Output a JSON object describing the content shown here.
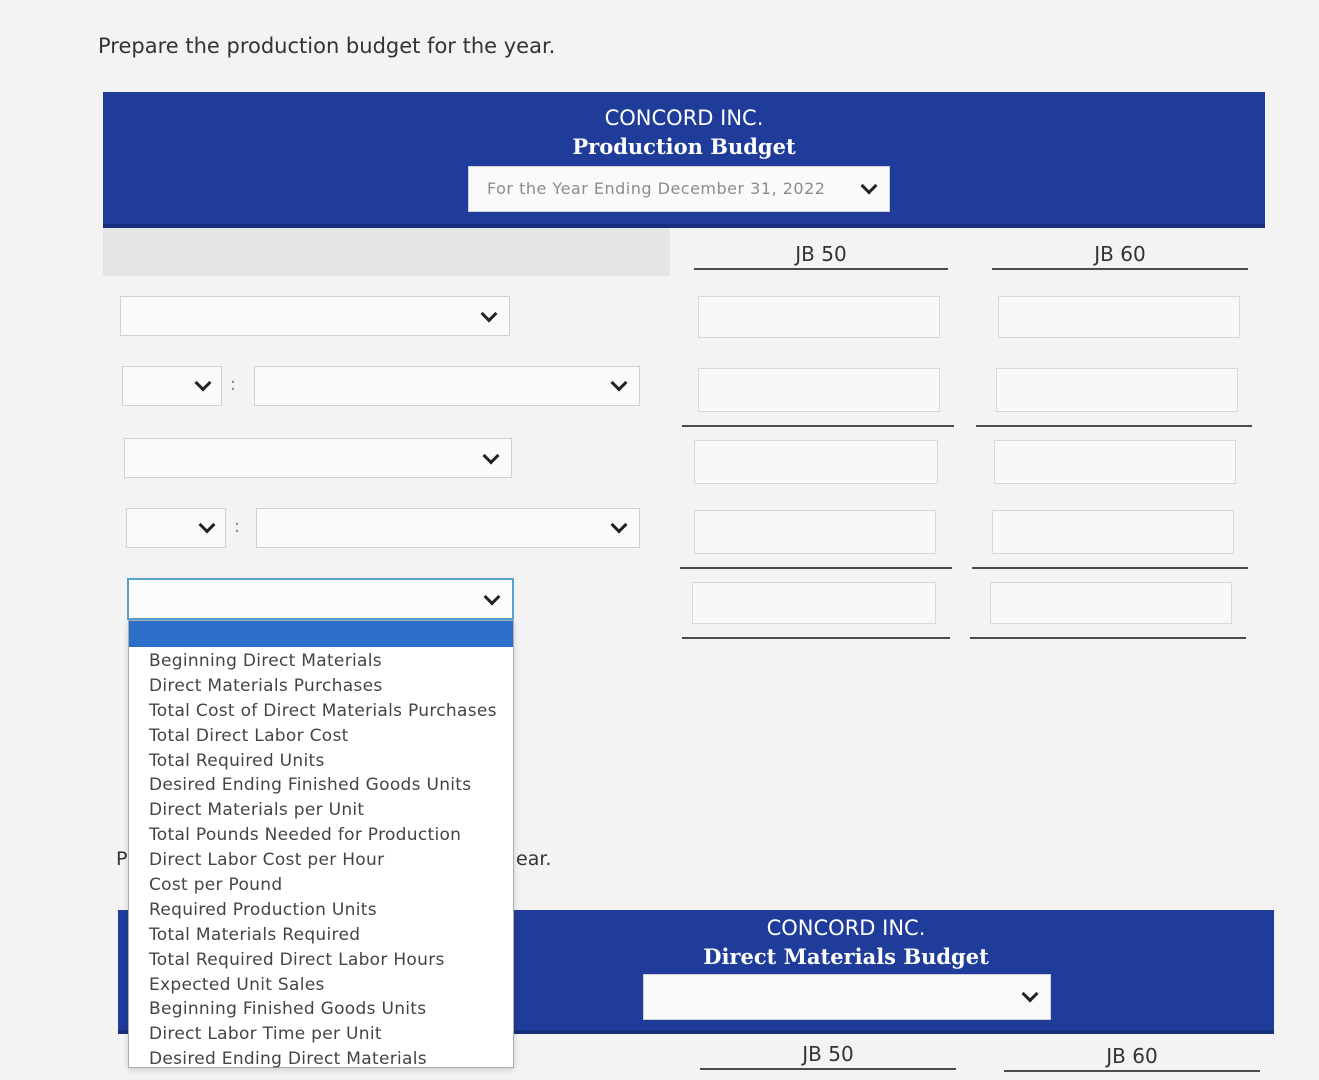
{
  "prompt_text": "Prepare the production budget for the year.",
  "production_budget": {
    "company": "CONCORD INC.",
    "title": "Production Budget",
    "period_select_value": "For the Year Ending December 31, 2022",
    "col_jb50": "JB 50",
    "col_jb60": "JB 60"
  },
  "dropdown_options": [
    "Beginning Direct Materials",
    "Direct Materials Purchases",
    "Total Cost of Direct Materials Purchases",
    "Total Direct Labor Cost",
    "Total Required Units",
    "Desired Ending Finished Goods Units",
    "Direct Materials per Unit",
    "Total Pounds Needed for Production",
    "Direct Labor Cost per Hour",
    "Cost per Pound",
    "Required Production Units",
    "Total Materials Required",
    "Total Required Direct Labor Hours",
    "Expected Unit Sales",
    "Beginning Finished Goods Units",
    "Direct Labor Time per Unit",
    "Desired Ending Direct Materials"
  ],
  "second_prompt_fragment_left": "P",
  "second_prompt_fragment_right": "ear.",
  "materials_budget": {
    "company": "CONCORD INC.",
    "title": "Direct Materials Budget",
    "period_select_value": "",
    "col_jb50": "JB 50",
    "col_jb60": "JB 60"
  },
  "colors": {
    "header_blue": "#1f3c9a",
    "dropdown_highlight": "#2d6ec9",
    "focus_border": "#5aa0d0"
  },
  "icons": {
    "select_arrow": "chevron-down-icon"
  }
}
